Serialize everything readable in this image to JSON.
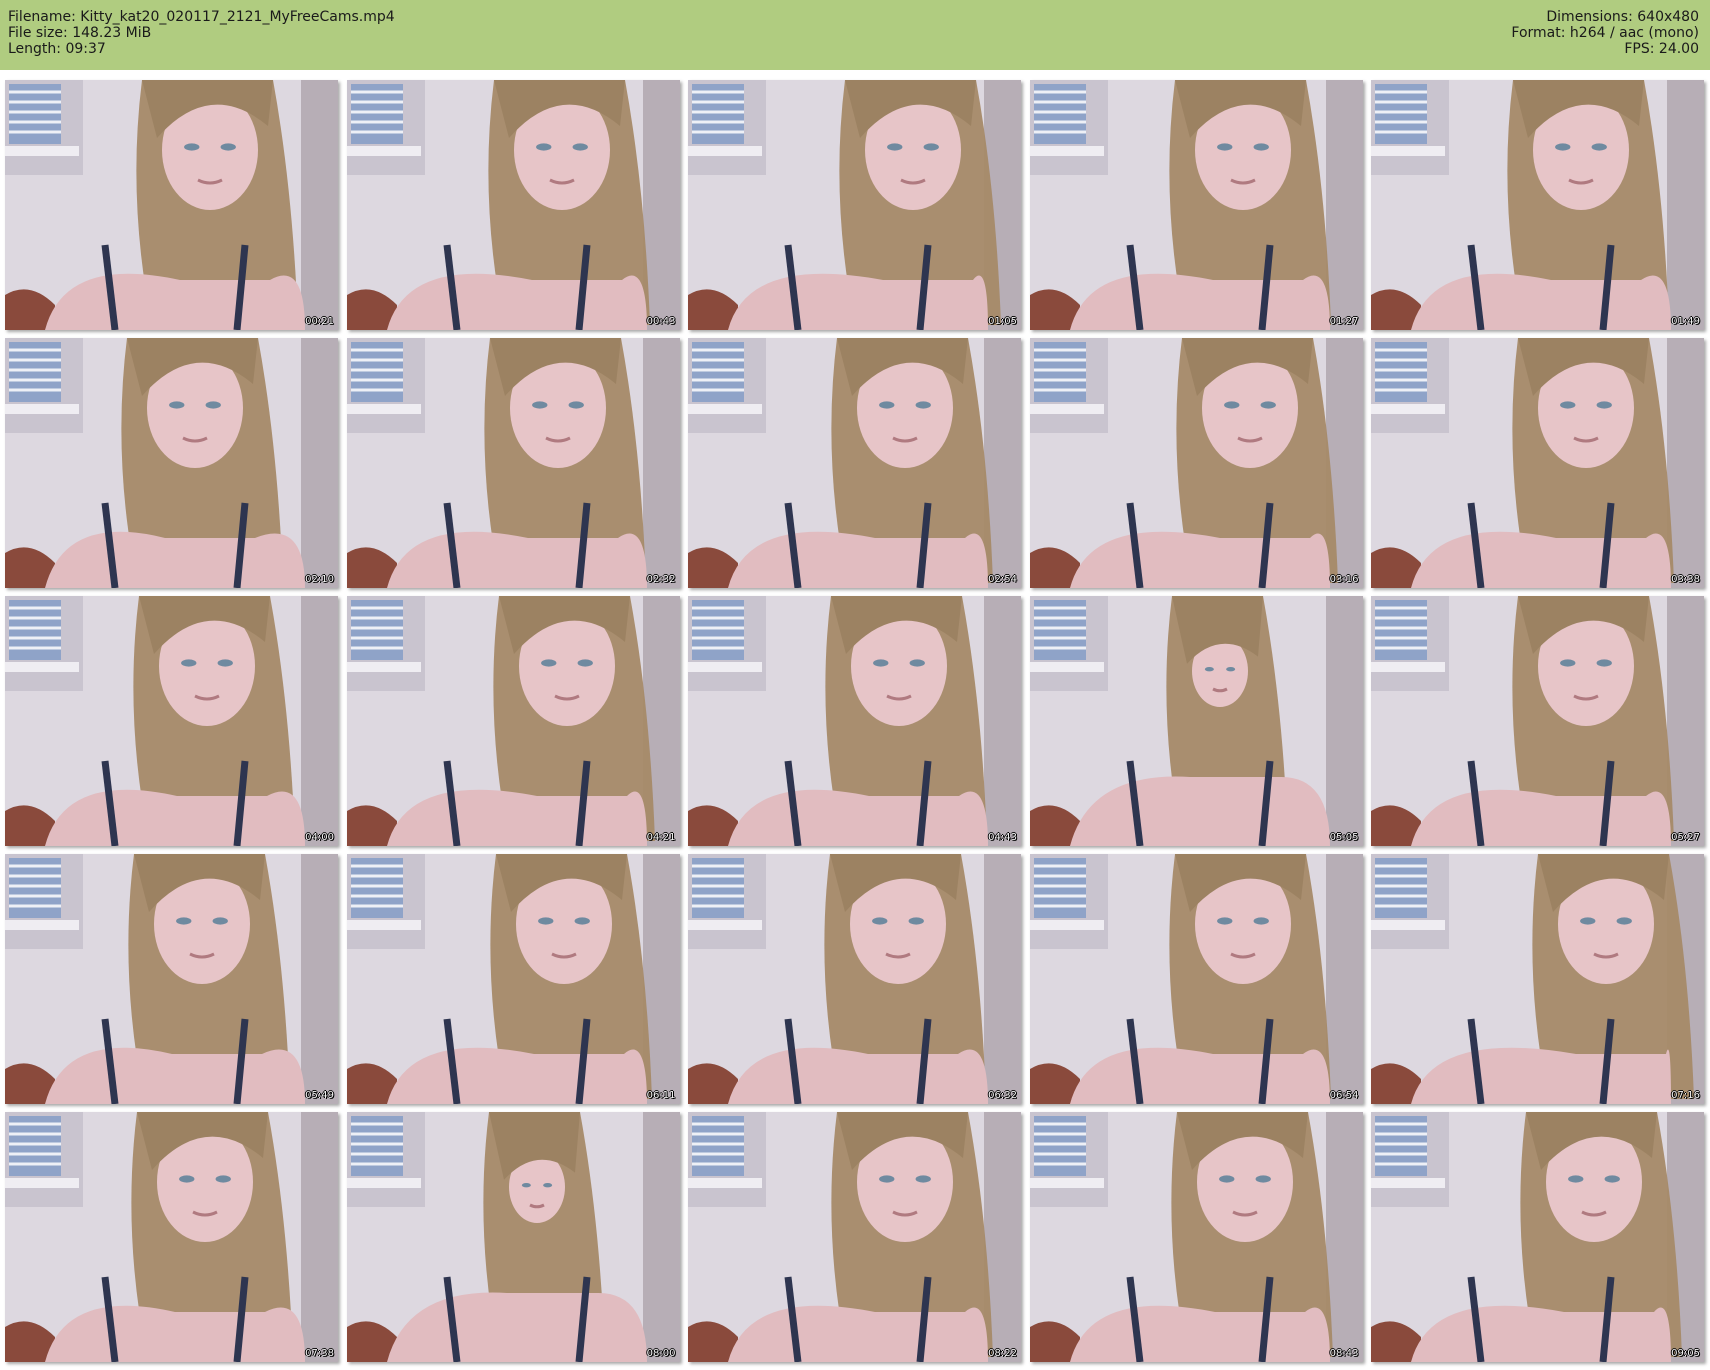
{
  "header": {
    "filename": "Filename: Kitty_kat20_020117_2121_MyFreeCams.mp4",
    "file_size": "File size: 148.23 MiB",
    "length": "Length: 09:37",
    "dimensions": "Dimensions: 640x480",
    "format": "Format: h264 / aac (mono)",
    "fps": "FPS: 24.00"
  },
  "thumbnails": [
    {
      "time": "00:21"
    },
    {
      "time": "00:43"
    },
    {
      "time": "01:05"
    },
    {
      "time": "01:27"
    },
    {
      "time": "01:49"
    },
    {
      "time": "02:10"
    },
    {
      "time": "02:32"
    },
    {
      "time": "02:54"
    },
    {
      "time": "03:16"
    },
    {
      "time": "03:38"
    },
    {
      "time": "04:00"
    },
    {
      "time": "04:21"
    },
    {
      "time": "04:43"
    },
    {
      "time": "05:05"
    },
    {
      "time": "05:27"
    },
    {
      "time": "05:49"
    },
    {
      "time": "06:11"
    },
    {
      "time": "06:32"
    },
    {
      "time": "06:54"
    },
    {
      "time": "07:16"
    },
    {
      "time": "07:38"
    },
    {
      "time": "08:00"
    },
    {
      "time": "08:22"
    },
    {
      "time": "08:43"
    },
    {
      "time": "09:05"
    }
  ],
  "colors": {
    "header_bg": "#b0cc80",
    "wall": "#ddd8e0",
    "skin": "#e7c5c8",
    "hair": "#a58a68",
    "clothing": "#2e3550"
  }
}
